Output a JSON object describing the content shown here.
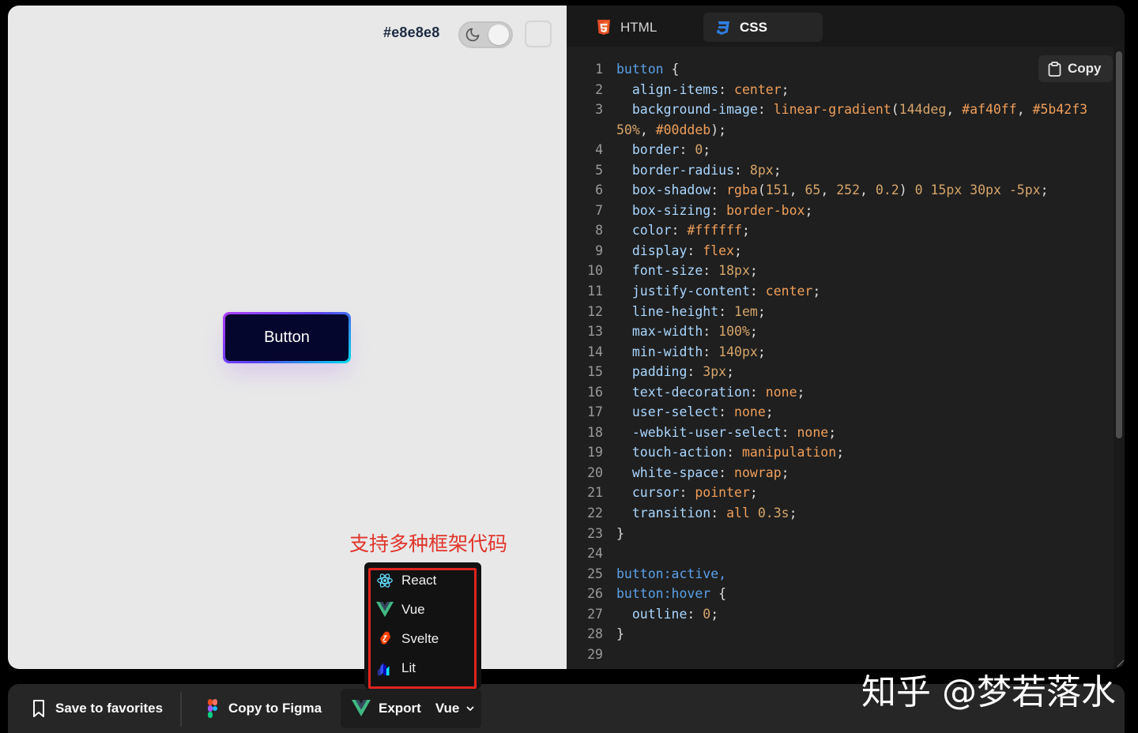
{
  "preview": {
    "bg_hex_label": "#e8e8e8",
    "demo_button_label": "Button",
    "annotation": "支持多种框架代码"
  },
  "tabs": [
    {
      "label": "HTML",
      "icon": "html5-icon",
      "active": false
    },
    {
      "label": "CSS",
      "icon": "css3-icon",
      "active": true
    }
  ],
  "copy_button": {
    "label": "Copy",
    "icon": "clipboard-icon"
  },
  "code_lines": [
    {
      "n": "1",
      "parts": [
        [
          "sel",
          "button"
        ],
        [
          "pun",
          " {"
        ]
      ]
    },
    {
      "n": "2",
      "parts": [
        [
          "pun",
          "  "
        ],
        [
          "prop",
          "align-items"
        ],
        [
          "pun",
          ": "
        ],
        [
          "val",
          "center"
        ],
        [
          "pun",
          ";"
        ]
      ]
    },
    {
      "n": "3",
      "parts": [
        [
          "pun",
          "  "
        ],
        [
          "prop",
          "background-image"
        ],
        [
          "pun",
          ": "
        ],
        [
          "val",
          "linear-gradient"
        ],
        [
          "pun",
          "("
        ],
        [
          "num",
          "144deg"
        ],
        [
          "pun",
          ", "
        ],
        [
          "val",
          "#af40ff"
        ],
        [
          "pun",
          ", "
        ],
        [
          "val",
          "#5b42f3"
        ]
      ]
    },
    {
      "n": "",
      "parts": [
        [
          "num",
          "50%"
        ],
        [
          "pun",
          ", "
        ],
        [
          "val",
          "#00ddeb"
        ],
        [
          "pun",
          ");"
        ]
      ]
    },
    {
      "n": "4",
      "parts": [
        [
          "pun",
          "  "
        ],
        [
          "prop",
          "border"
        ],
        [
          "pun",
          ": "
        ],
        [
          "num",
          "0"
        ],
        [
          "pun",
          ";"
        ]
      ]
    },
    {
      "n": "5",
      "parts": [
        [
          "pun",
          "  "
        ],
        [
          "prop",
          "border-radius"
        ],
        [
          "pun",
          ": "
        ],
        [
          "num",
          "8px"
        ],
        [
          "pun",
          ";"
        ]
      ]
    },
    {
      "n": "6",
      "parts": [
        [
          "pun",
          "  "
        ],
        [
          "prop",
          "box-shadow"
        ],
        [
          "pun",
          ": "
        ],
        [
          "val",
          "rgba"
        ],
        [
          "pun",
          "("
        ],
        [
          "num",
          "151"
        ],
        [
          "pun",
          ", "
        ],
        [
          "num",
          "65"
        ],
        [
          "pun",
          ", "
        ],
        [
          "num",
          "252"
        ],
        [
          "pun",
          ", "
        ],
        [
          "num",
          "0.2"
        ],
        [
          "pun",
          ") "
        ],
        [
          "num",
          "0"
        ],
        [
          "pun",
          " "
        ],
        [
          "num",
          "15px"
        ],
        [
          "pun",
          " "
        ],
        [
          "num",
          "30px"
        ],
        [
          "pun",
          " "
        ],
        [
          "num",
          "-5px"
        ],
        [
          "pun",
          ";"
        ]
      ]
    },
    {
      "n": "7",
      "parts": [
        [
          "pun",
          "  "
        ],
        [
          "prop",
          "box-sizing"
        ],
        [
          "pun",
          ": "
        ],
        [
          "val",
          "border-box"
        ],
        [
          "pun",
          ";"
        ]
      ]
    },
    {
      "n": "8",
      "parts": [
        [
          "pun",
          "  "
        ],
        [
          "prop",
          "color"
        ],
        [
          "pun",
          ": "
        ],
        [
          "val",
          "#ffffff"
        ],
        [
          "pun",
          ";"
        ]
      ]
    },
    {
      "n": "9",
      "parts": [
        [
          "pun",
          "  "
        ],
        [
          "prop",
          "display"
        ],
        [
          "pun",
          ": "
        ],
        [
          "val",
          "flex"
        ],
        [
          "pun",
          ";"
        ]
      ]
    },
    {
      "n": "10",
      "parts": [
        [
          "pun",
          "  "
        ],
        [
          "prop",
          "font-size"
        ],
        [
          "pun",
          ": "
        ],
        [
          "num",
          "18px"
        ],
        [
          "pun",
          ";"
        ]
      ]
    },
    {
      "n": "11",
      "parts": [
        [
          "pun",
          "  "
        ],
        [
          "prop",
          "justify-content"
        ],
        [
          "pun",
          ": "
        ],
        [
          "val",
          "center"
        ],
        [
          "pun",
          ";"
        ]
      ]
    },
    {
      "n": "12",
      "parts": [
        [
          "pun",
          "  "
        ],
        [
          "prop",
          "line-height"
        ],
        [
          "pun",
          ": "
        ],
        [
          "num",
          "1em"
        ],
        [
          "pun",
          ";"
        ]
      ]
    },
    {
      "n": "13",
      "parts": [
        [
          "pun",
          "  "
        ],
        [
          "prop",
          "max-width"
        ],
        [
          "pun",
          ": "
        ],
        [
          "num",
          "100%"
        ],
        [
          "pun",
          ";"
        ]
      ]
    },
    {
      "n": "14",
      "parts": [
        [
          "pun",
          "  "
        ],
        [
          "prop",
          "min-width"
        ],
        [
          "pun",
          ": "
        ],
        [
          "num",
          "140px"
        ],
        [
          "pun",
          ";"
        ]
      ]
    },
    {
      "n": "15",
      "parts": [
        [
          "pun",
          "  "
        ],
        [
          "prop",
          "padding"
        ],
        [
          "pun",
          ": "
        ],
        [
          "num",
          "3px"
        ],
        [
          "pun",
          ";"
        ]
      ]
    },
    {
      "n": "16",
      "parts": [
        [
          "pun",
          "  "
        ],
        [
          "prop",
          "text-decoration"
        ],
        [
          "pun",
          ": "
        ],
        [
          "val",
          "none"
        ],
        [
          "pun",
          ";"
        ]
      ]
    },
    {
      "n": "17",
      "parts": [
        [
          "pun",
          "  "
        ],
        [
          "prop",
          "user-select"
        ],
        [
          "pun",
          ": "
        ],
        [
          "val",
          "none"
        ],
        [
          "pun",
          ";"
        ]
      ]
    },
    {
      "n": "18",
      "parts": [
        [
          "pun",
          "  "
        ],
        [
          "prop",
          "-webkit-user-select"
        ],
        [
          "pun",
          ": "
        ],
        [
          "val",
          "none"
        ],
        [
          "pun",
          ";"
        ]
      ]
    },
    {
      "n": "19",
      "parts": [
        [
          "pun",
          "  "
        ],
        [
          "prop",
          "touch-action"
        ],
        [
          "pun",
          ": "
        ],
        [
          "val",
          "manipulation"
        ],
        [
          "pun",
          ";"
        ]
      ]
    },
    {
      "n": "20",
      "parts": [
        [
          "pun",
          "  "
        ],
        [
          "prop",
          "white-space"
        ],
        [
          "pun",
          ": "
        ],
        [
          "val",
          "nowrap"
        ],
        [
          "pun",
          ";"
        ]
      ]
    },
    {
      "n": "21",
      "parts": [
        [
          "pun",
          "  "
        ],
        [
          "prop",
          "cursor"
        ],
        [
          "pun",
          ": "
        ],
        [
          "val",
          "pointer"
        ],
        [
          "pun",
          ";"
        ]
      ]
    },
    {
      "n": "22",
      "parts": [
        [
          "pun",
          "  "
        ],
        [
          "prop",
          "transition"
        ],
        [
          "pun",
          ": "
        ],
        [
          "val",
          "all"
        ],
        [
          "pun",
          " "
        ],
        [
          "num",
          "0.3s"
        ],
        [
          "pun",
          ";"
        ]
      ]
    },
    {
      "n": "23",
      "parts": [
        [
          "pun",
          "}"
        ]
      ]
    },
    {
      "n": "24",
      "parts": []
    },
    {
      "n": "25",
      "parts": [
        [
          "sel",
          "button:active,"
        ]
      ]
    },
    {
      "n": "26",
      "parts": [
        [
          "sel",
          "button:hover"
        ],
        [
          "pun",
          " {"
        ]
      ]
    },
    {
      "n": "27",
      "parts": [
        [
          "pun",
          "  "
        ],
        [
          "prop",
          "outline"
        ],
        [
          "pun",
          ": "
        ],
        [
          "num",
          "0"
        ],
        [
          "pun",
          ";"
        ]
      ]
    },
    {
      "n": "28",
      "parts": [
        [
          "pun",
          "}"
        ]
      ]
    },
    {
      "n": "29",
      "parts": []
    }
  ],
  "dropdown": {
    "items": [
      {
        "label": "React",
        "icon": "react-icon"
      },
      {
        "label": "Vue",
        "icon": "vue-icon"
      },
      {
        "label": "Svelte",
        "icon": "svelte-icon"
      },
      {
        "label": "Lit",
        "icon": "lit-icon"
      }
    ]
  },
  "bottombar": {
    "save_label": "Save to favorites",
    "figma_label": "Copy to Figma",
    "export_label": "Export",
    "framework_selected": "Vue"
  },
  "watermark": "知乎 @梦若落水",
  "colors": {
    "preview_bg": "#e8e8e8",
    "code_bg": "#1f1f1f",
    "annotation_red": "#e0352b",
    "gradient_start": "#af40ff",
    "gradient_mid": "#5b42f3",
    "gradient_end": "#00ddeb"
  }
}
